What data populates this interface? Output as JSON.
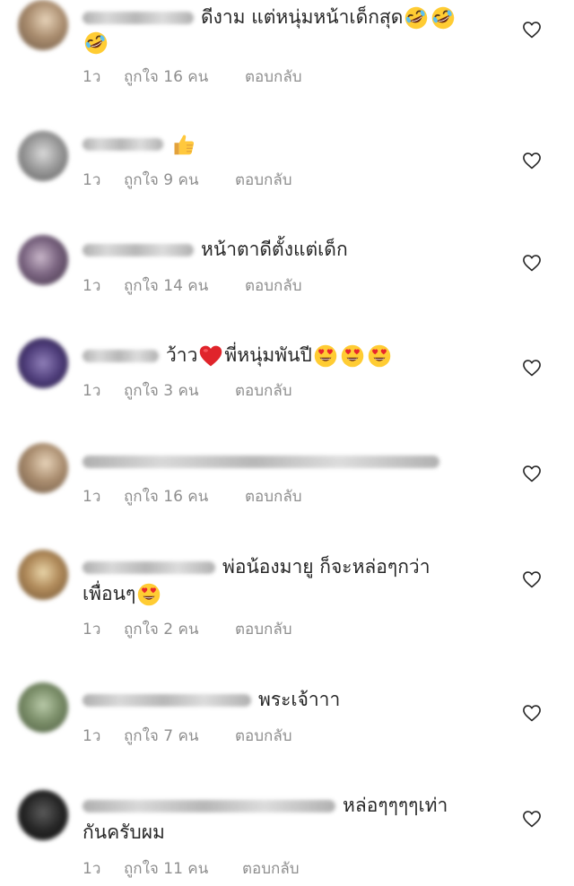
{
  "labels": {
    "reply": "ตอบกลับ"
  },
  "comments": [
    {
      "text": "ดีงาม แต่หนุ่มหน้าเด็กสุด",
      "emojis": [
        "rofl-emoji",
        "rofl-emoji",
        "rofl-emoji"
      ],
      "time": "1ว",
      "likes": "ถูกใจ 16 คน"
    },
    {
      "text": "",
      "emojis": [
        "thumbs-up-emoji"
      ],
      "time": "1ว",
      "likes": "ถูกใจ 9 คน"
    },
    {
      "text": "หน้าตาดีตั้งแต่เด็ก",
      "emojis": [],
      "time": "1ว",
      "likes": "ถูกใจ 14 คน"
    },
    {
      "text_before": "ว้าว",
      "text_after": "พี่หนุ่มพันปี",
      "emojis": [
        "red-heart-emoji",
        "heart-eyes-emoji",
        "heart-eyes-emoji",
        "heart-eyes-emoji"
      ],
      "time": "1ว",
      "likes": "ถูกใจ 3 คน"
    },
    {
      "text": "",
      "emojis": [],
      "time": "1ว",
      "likes": "ถูกใจ 16 คน"
    },
    {
      "text": "พ่อน้องมายู ก็จะหล่อๆกว่า",
      "text_line2": "เพื่อนๆ",
      "emojis": [
        "heart-eyes-emoji"
      ],
      "time": "1ว",
      "likes": "ถูกใจ 2 คน"
    },
    {
      "text": "พระเจ้าาา",
      "emojis": [],
      "time": "1ว",
      "likes": "ถูกใจ 7 คน"
    },
    {
      "text": "หล่อๆๆๆๆเท่า",
      "text_line2": "กันครับผม",
      "emojis": [],
      "time": "1ว",
      "likes": "ถูกใจ 11 คน"
    }
  ],
  "colors": {
    "text": "#262626",
    "meta": "#8e8e8e",
    "heart_outline": "#262626",
    "background": "#ffffff"
  }
}
